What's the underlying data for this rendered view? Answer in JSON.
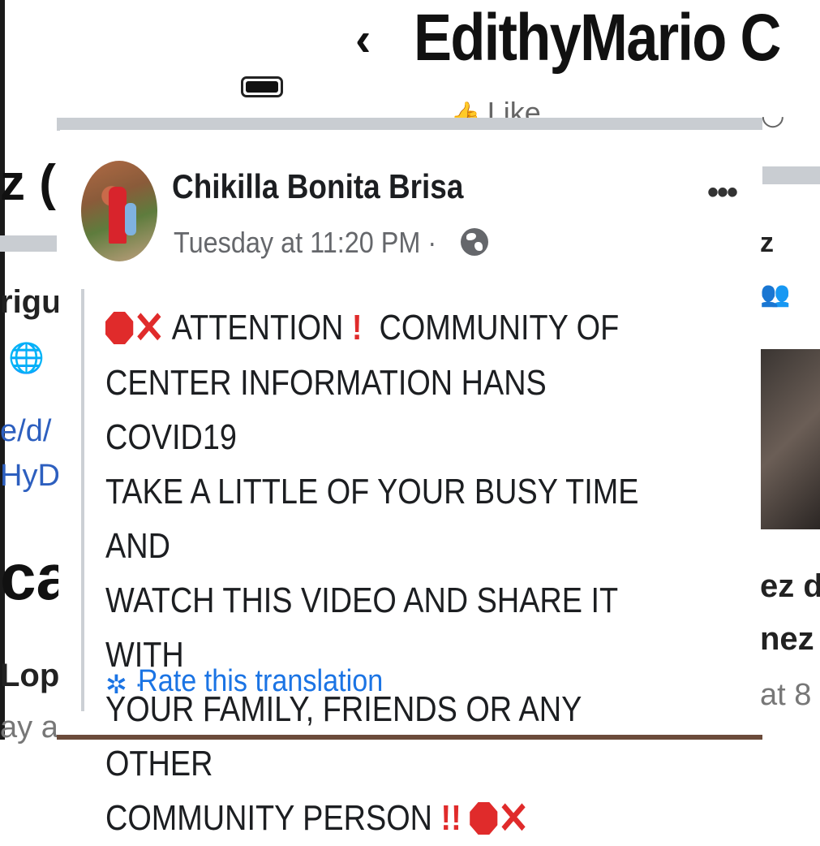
{
  "background": {
    "page_title": "EdithyMario C",
    "back_glyph": "‹",
    "like_label": "Like",
    "left_column": {
      "truncated_name": "z (",
      "truncated_name_2": "rigu",
      "link_line_1": "e/d/",
      "link_line_2": "HyD",
      "truncated_heading": "ca",
      "truncated_name_3": "Lop",
      "truncated_time": "ay at"
    },
    "right_column": {
      "truncated_name": "z",
      "truncated_line_1": "ez d",
      "truncated_line_2": "nez a",
      "truncated_time": "at 8"
    }
  },
  "post": {
    "author_name": "Chikilla Bonita Brisa",
    "timestamp": "Tuesday at 11:20 PM ·",
    "privacy_icon": "globe-icon",
    "more_label": "•••",
    "text": {
      "line_1": "ATTENTION",
      "line_1b": "COMMUNITY OF",
      "line_2": "CENTER INFORMATION HANS COVID19",
      "line_3": "TAKE A LITTLE OF YOUR BUSY TIME AND",
      "line_4": "WATCH THIS VIDEO AND SHARE IT WITH",
      "line_5": "YOUR FAMILY, FRIENDS OR ANY OTHER",
      "line_6": "COMMUNITY PERSON"
    },
    "translation_link": "Rate this translation",
    "translation_separator": "·"
  },
  "colors": {
    "link_blue": "#1b74e4",
    "alert_red": "#e02b2b",
    "secondary_text": "#65676b"
  }
}
